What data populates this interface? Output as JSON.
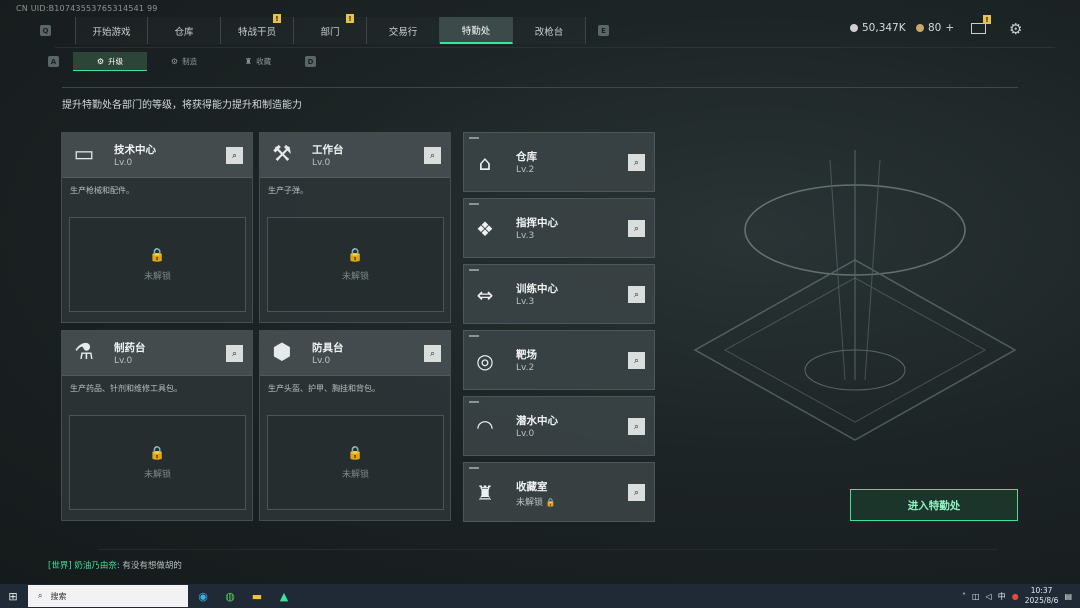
{
  "uid": "CN UID:B10743553765314541 99",
  "nav": {
    "left_key": "Q",
    "right_key": "E",
    "tabs": [
      {
        "label": "开始游戏",
        "flag": ""
      },
      {
        "label": "仓库",
        "flag": ""
      },
      {
        "label": "特战干员",
        "flag": "!"
      },
      {
        "label": "部门",
        "flag": "!"
      },
      {
        "label": "交易行",
        "flag": ""
      },
      {
        "label": "特勤处",
        "flag": ""
      },
      {
        "label": "改枪台",
        "flag": ""
      }
    ],
    "active_tab": "特勤处"
  },
  "subnav": {
    "left_key": "A",
    "right_key": "D",
    "tabs": [
      {
        "label": "升级",
        "icon": "⚙"
      },
      {
        "label": "制造",
        "icon": "⚙"
      },
      {
        "label": "收藏",
        "icon": "♜"
      }
    ],
    "active_tab": "升级"
  },
  "currency": {
    "silver": "50,347K",
    "gold": "80",
    "gold_add": "+"
  },
  "mail_flag": "!",
  "headline": "提升特勤处各部门的等级，将获得能力提升和制造能力",
  "big_cards": [
    {
      "name": "技术中心",
      "level": "Lv.0",
      "desc": "生产枪械和配件。",
      "locked_text": "未解锁",
      "icon": "computer-icon"
    },
    {
      "name": "工作台",
      "level": "Lv.0",
      "desc": "生产子弹。",
      "locked_text": "未解锁",
      "icon": "tools-icon"
    },
    {
      "name": "制药台",
      "level": "Lv.0",
      "desc": "生产药品、针剂和维修工具包。",
      "locked_text": "未解锁",
      "icon": "microscope-icon"
    },
    {
      "name": "防具台",
      "level": "Lv.0",
      "desc": "生产头盔、护甲、胸挂和背包。",
      "locked_text": "未解锁",
      "icon": "armor-icon"
    }
  ],
  "small_cards": [
    {
      "name": "仓库",
      "level": "Lv.2",
      "icon": "warehouse-icon"
    },
    {
      "name": "指挥中心",
      "level": "Lv.3",
      "icon": "command-icon"
    },
    {
      "name": "训练中心",
      "level": "Lv.3",
      "icon": "dumbbell-icon"
    },
    {
      "name": "靶场",
      "level": "Lv.2",
      "icon": "target-icon"
    },
    {
      "name": "潜水中心",
      "level": "Lv.0",
      "icon": "diving-mask-icon"
    },
    {
      "name": "收藏室",
      "level": "未解锁",
      "icon": "trophy-case-icon"
    }
  ],
  "enter_button": "进入特勤处",
  "chat": {
    "channel": "[世界]",
    "user": "奶油乃由奈",
    "message": ": 有没有想做胡的"
  },
  "taskbar": {
    "search_placeholder": "搜索",
    "ime": "中",
    "time": "10:37",
    "date": "2025/8/6"
  }
}
